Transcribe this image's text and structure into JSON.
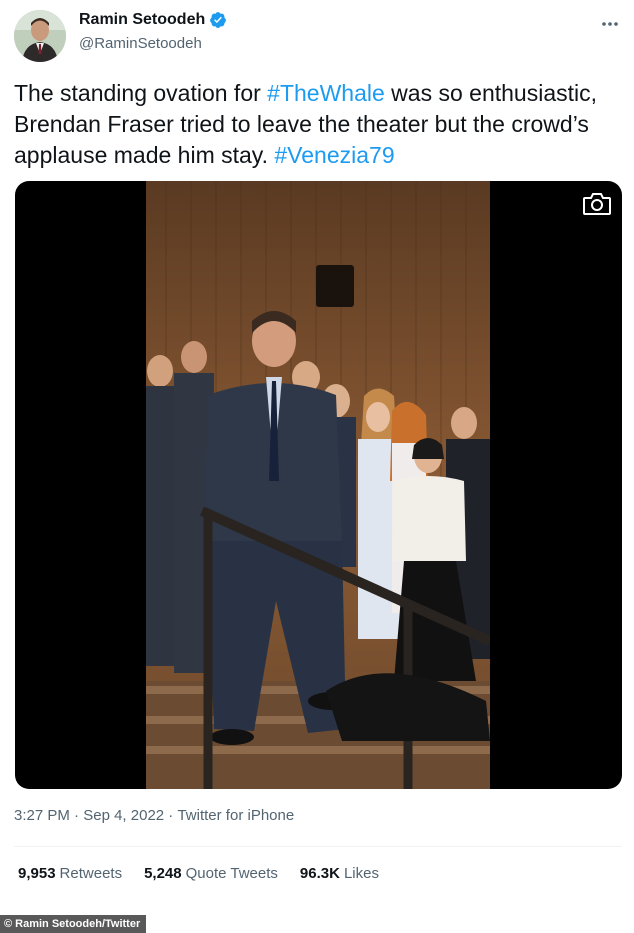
{
  "author": {
    "display_name": "Ramin Setoodeh",
    "handle": "@RaminSetoodeh",
    "verified": true
  },
  "tweet": {
    "text_parts": [
      {
        "text": "The standing ovation for ",
        "type": "text"
      },
      {
        "text": "#TheWhale",
        "type": "hashtag"
      },
      {
        "text": " was so enthusiastic, Brendan Fraser tried to leave the theater but the crowd’s applause made him stay. ",
        "type": "text"
      },
      {
        "text": "#Venezia79",
        "type": "hashtag"
      }
    ],
    "time": "3:27 PM",
    "date": "Sep 4, 2022",
    "source": "Twitter for iPhone"
  },
  "stats": {
    "retweets_count": "9,953",
    "retweets_label": "Retweets",
    "quotes_count": "5,248",
    "quotes_label": "Quote Tweets",
    "likes_count": "96.3K",
    "likes_label": "Likes"
  },
  "credit": "© Ramin Setoodeh/Twitter",
  "colors": {
    "hashtag": "#1d9bf0",
    "verified": "#1d9bf0",
    "secondary_text": "#536471"
  },
  "icons": [
    "verified-badge-icon",
    "more-options-icon",
    "camera-icon"
  ]
}
